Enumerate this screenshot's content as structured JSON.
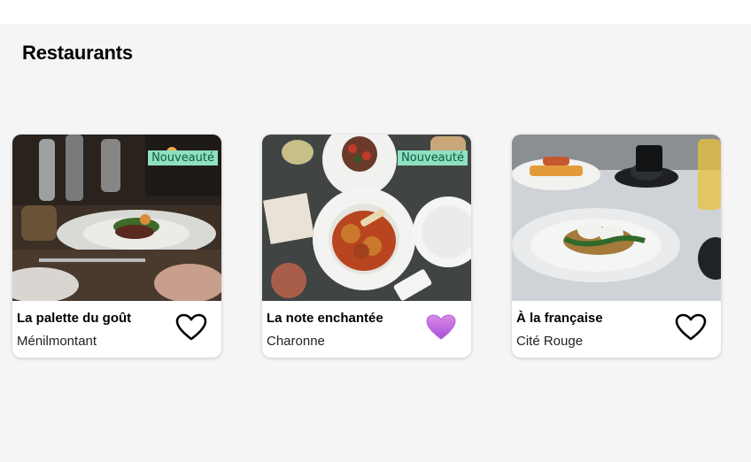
{
  "page": {
    "title": "Restaurants"
  },
  "colors": {
    "background": "#f5f5f5",
    "badge_bg": "#8ee0c0",
    "badge_text": "#0d5c44",
    "favorite_fill": "#c06ae0"
  },
  "restaurants": [
    {
      "name": "La palette du goût",
      "area": "Ménilmontant",
      "badge": "Nouveauté",
      "favorite": false,
      "favorite_icon": "heart-outline-icon"
    },
    {
      "name": "La note enchantée",
      "area": "Charonne",
      "badge": "Nouveauté",
      "favorite": true,
      "favorite_icon": "heart-filled-icon"
    },
    {
      "name": "À la française",
      "area": "Cité Rouge",
      "badge": "",
      "favorite": false,
      "favorite_icon": "heart-outline-icon"
    }
  ]
}
